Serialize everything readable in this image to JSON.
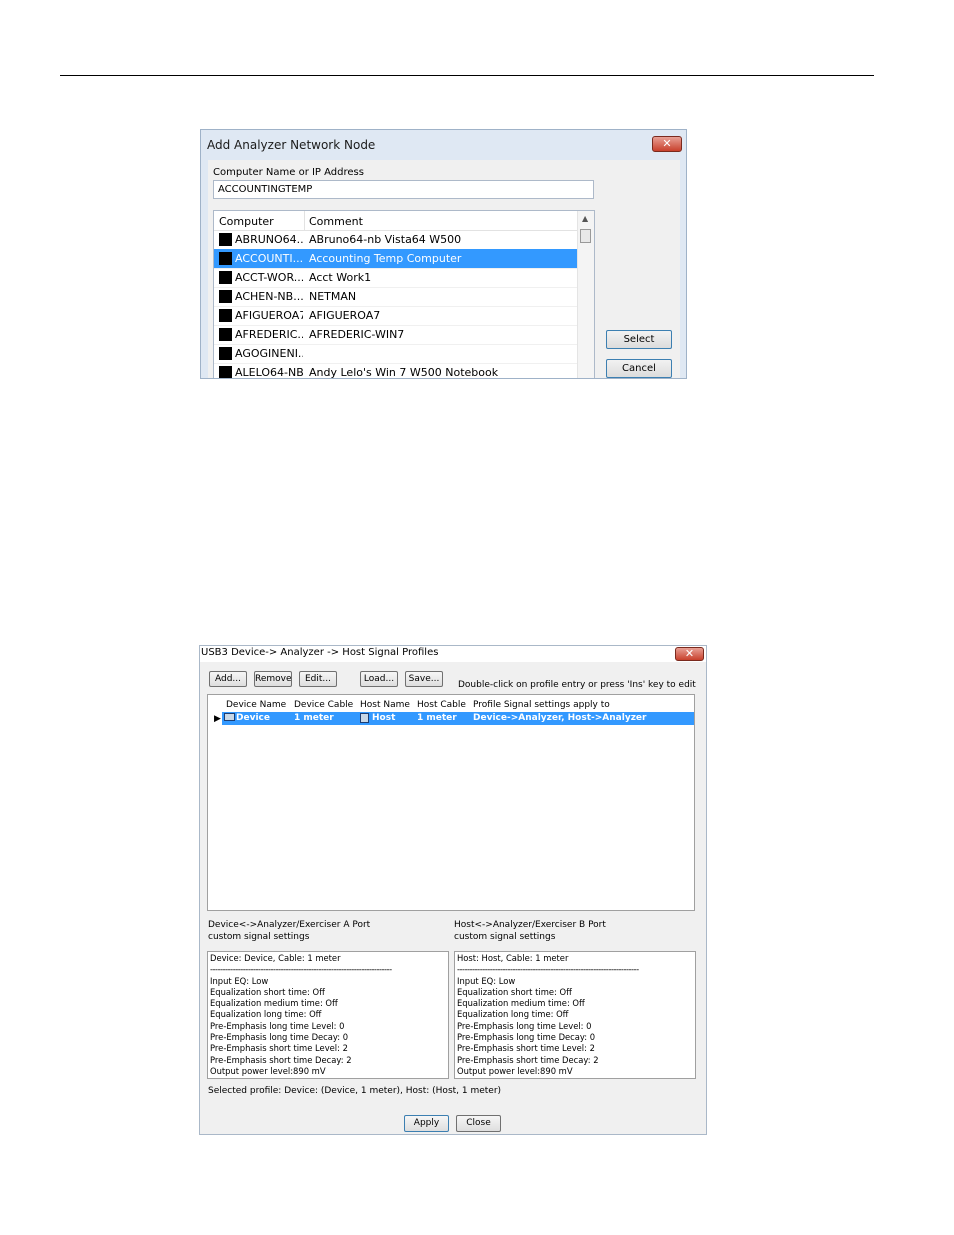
{
  "dialog1": {
    "title": "Add Analyzer Network Node",
    "close_glyph": "✕",
    "field_label": "Computer Name or IP Address",
    "field_value": "ACCOUNTINGTEMP",
    "columns": {
      "computer": "Computer",
      "comment": "Comment"
    },
    "rows": [
      {
        "computer": "ABRUNO64...",
        "comment": "ABruno64-nb Vista64 W500"
      },
      {
        "computer": "ACCOUNTI...",
        "comment": "Accounting Temp Computer"
      },
      {
        "computer": "ACCT-WOR...",
        "comment": "Acct Work1"
      },
      {
        "computer": "ACHEN-NB...",
        "comment": "NETMAN"
      },
      {
        "computer": "AFIGUEROA7",
        "comment": "AFIGUEROA7"
      },
      {
        "computer": "AFREDERIC...",
        "comment": "AFREDERIC-WIN7"
      },
      {
        "computer": "AGOGINENI...",
        "comment": ""
      },
      {
        "computer": "ALELO64-NB",
        "comment": "Andy Lelo's Win 7 W500 Notebook"
      }
    ],
    "selected_row": 1,
    "select_label": "Select",
    "cancel_label": "Cancel"
  },
  "dialog2": {
    "title": "USB3 Device-> Analyzer -> Host Signal Profiles",
    "close_glyph": "✕",
    "toolbar": {
      "add": "Add...",
      "remove": "Remove",
      "edit": "Edit...",
      "load": "Load...",
      "save": "Save..."
    },
    "hint": "Double-click on profile entry or press 'Ins' key to edit",
    "columns": {
      "device_name": "Device Name",
      "device_cable": "Device Cable",
      "host_name": "Host Name",
      "host_cable": "Host Cable",
      "apply_to": "Profile Signal settings apply to"
    },
    "row": {
      "device_name": "Device",
      "device_cable": "1 meter",
      "host_name": "Host",
      "host_cable": "1 meter",
      "apply_to": "Device->Analyzer, Host->Analyzer"
    },
    "left_label": {
      "line1": "Device<->Analyzer/Exerciser A Port",
      "line2": "custom signal settings"
    },
    "right_label": {
      "line1": "Host<->Analyzer/Exerciser B Port",
      "line2": "custom signal settings"
    },
    "left_box": {
      "header": "Device: Device, Cable: 1 meter",
      "separator": "------------------------------------------------------------------------",
      "lines": [
        "Input EQ: Low",
        "Equalization short time: Off",
        "Equalization medium time: Off",
        "Equalization long time: Off",
        "Pre-Emphasis long time Level: 0",
        "Pre-Emphasis long time Decay: 0",
        "Pre-Emphasis short time Level: 2",
        "Pre-Emphasis short time Decay: 2",
        "Output power level:890 mV"
      ]
    },
    "right_box": {
      "header": "Host: Host, Cable: 1 meter",
      "separator": "------------------------------------------------------------------------",
      "lines": [
        "Input EQ: Low",
        "Equalization short time: Off",
        "Equalization medium time: Off",
        "Equalization long time: Off",
        "Pre-Emphasis long time Level: 0",
        "Pre-Emphasis long time Decay: 0",
        "Pre-Emphasis short time Level: 2",
        "Pre-Emphasis short time Decay: 2",
        "Output power level:890 mV"
      ]
    },
    "selected_profile": "Selected profile: Device: (Device, 1 meter), Host: (Host, 1 meter)",
    "apply_label": "Apply",
    "close_label": "Close"
  }
}
